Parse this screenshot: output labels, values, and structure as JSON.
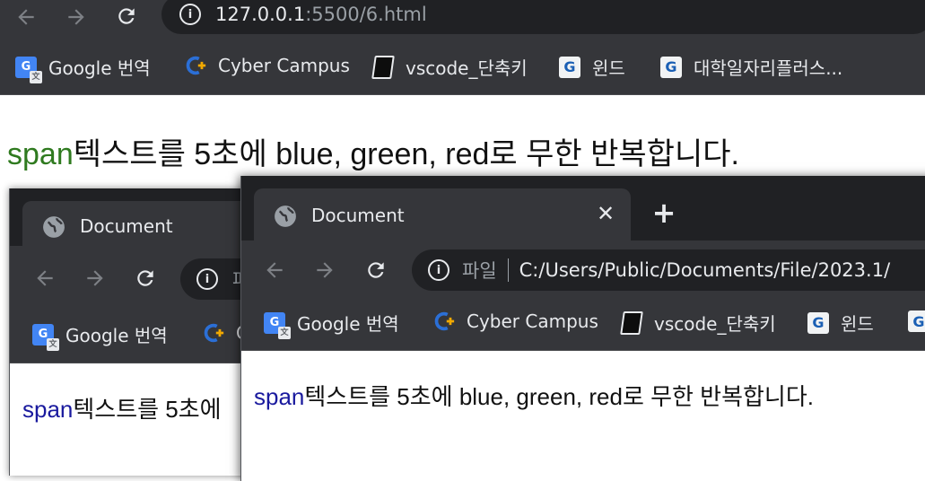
{
  "main": {
    "url_host": "127.0.0.1",
    "url_rest": ":5500/6.html",
    "bookmarks": [
      {
        "label": "Google 번역",
        "icon": "google-translate-icon"
      },
      {
        "label": "Cyber Campus",
        "icon": "cyber-campus-icon"
      },
      {
        "label": "vscode_단축키",
        "icon": "notebook-icon"
      },
      {
        "label": "윈드",
        "icon": "university-icon"
      },
      {
        "label": "대학일자리플러스...",
        "icon": "university-icon"
      }
    ],
    "page": {
      "span_text": "span",
      "rest_text": "텍스트를 5초에 blue, green, red로 무한 반복합니다."
    }
  },
  "back_window": {
    "tab_title": "Document",
    "url_prefix": "파",
    "bookmarks": [
      {
        "label": "Google 번역",
        "icon": "google-translate-icon"
      },
      {
        "label": "C",
        "icon": "cyber-campus-icon"
      }
    ],
    "page": {
      "span_text": "span",
      "rest_text": "텍스트를 5초에"
    }
  },
  "front_window": {
    "tab_title": "Document",
    "url_label": "파일",
    "url_path": "C:/Users/Public/Documents/File/2023.1/",
    "bookmarks": [
      {
        "label": "Google 번역",
        "icon": "google-translate-icon"
      },
      {
        "label": "Cyber Campus",
        "icon": "cyber-campus-icon"
      },
      {
        "label": "vscode_단축키",
        "icon": "notebook-icon"
      },
      {
        "label": "윈드",
        "icon": "university-icon"
      }
    ],
    "page": {
      "span_text": "span",
      "rest_text": "텍스트를 5초에 blue, green, red로 무한 반복합니다."
    }
  },
  "colors": {
    "chrome_bg": "#35363a",
    "tabstrip_bg": "#202124",
    "omnibox_bg": "#202124",
    "span_green": "#2f7a1f",
    "span_blue": "#1a1a9e"
  }
}
